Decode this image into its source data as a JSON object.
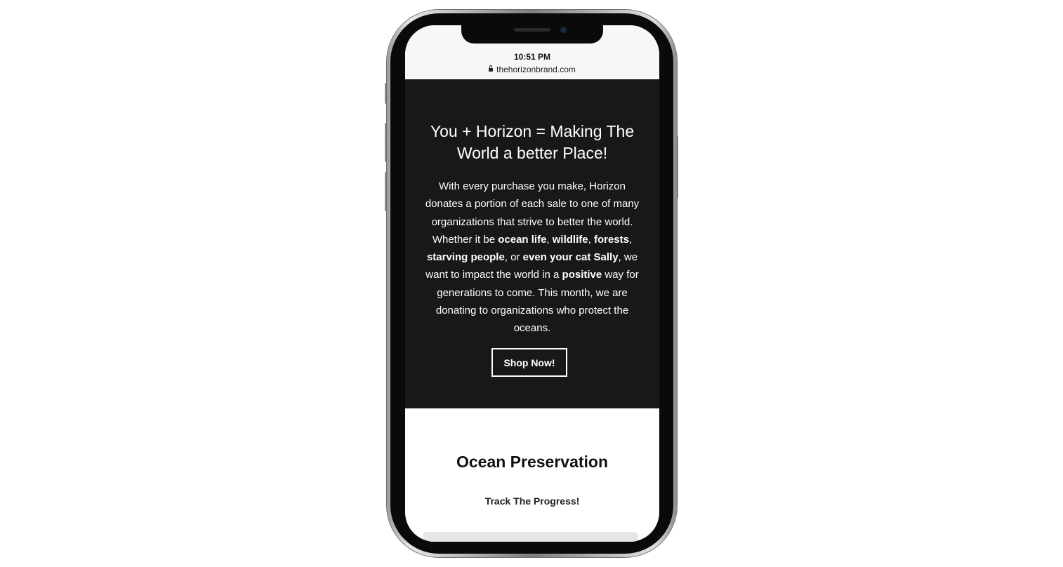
{
  "status_bar": {
    "time": "10:51 PM",
    "url": "thehorizonbrand.com"
  },
  "hero": {
    "title": "You + Horizon = Making The World a better Place!",
    "body": [
      {
        "text": "With every purchase you make, Horizon donates a portion of each sale to one of many organizations that strive to better the world. Whether it be ",
        "bold": false
      },
      {
        "text": "ocean life",
        "bold": true
      },
      {
        "text": ", ",
        "bold": false
      },
      {
        "text": "wildlife",
        "bold": true
      },
      {
        "text": ", ",
        "bold": false
      },
      {
        "text": "forests",
        "bold": true
      },
      {
        "text": ", ",
        "bold": false
      },
      {
        "text": "starving people",
        "bold": true
      },
      {
        "text": ", or ",
        "bold": false
      },
      {
        "text": "even your cat Sally",
        "bold": true
      },
      {
        "text": ", we want to impact the world in a ",
        "bold": false
      },
      {
        "text": "positive",
        "bold": true
      },
      {
        "text": " way for generations to come. This month, we are donating to organizations who protect the oceans.",
        "bold": false
      }
    ],
    "cta_label": "Shop Now!"
  },
  "section": {
    "title": "Ocean Preservation",
    "subtitle": "Track The Progress!"
  },
  "colors": {
    "hero_bg": "#181818",
    "page_bg": "#ffffff",
    "progress_track": "#e6e6e6"
  }
}
